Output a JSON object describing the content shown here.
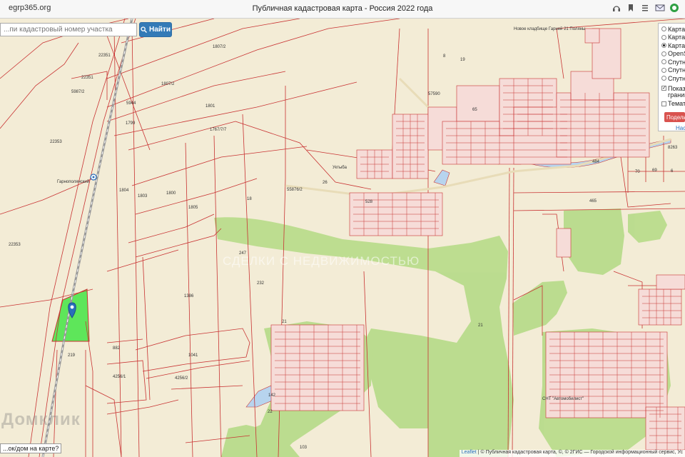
{
  "browser": {
    "url": "egrp365.org",
    "title": "Публичная кадастровая карта - Россия 2022 года"
  },
  "search": {
    "placeholder": "...пи кадастровый номер участка",
    "button_label": "Найти"
  },
  "layers": {
    "options": [
      "Карта",
      "Карта",
      "Карта",
      "OpenS",
      "Спутн",
      "Спутн",
      "Спутн"
    ],
    "selected_index": 2,
    "checkboxes": [
      {
        "label": "Показа границ",
        "checked": true
      },
      {
        "label": "Темати",
        "checked": false
      }
    ],
    "share_label": "Подели",
    "settings_label": "Наст"
  },
  "feedback_label": "...ок/дом на карте?",
  "attribution": {
    "leaflet": "Leaflet",
    "rest": "| © Публичная кадастровая карта, ©, © 2ГИС — Городской информационный сервис, Ус"
  },
  "watermarks": {
    "brand": "Домклик",
    "center": "СДЕЛКИ С НЕДВИЖИМОСТЬЮ"
  },
  "map_labels": {
    "parcel_numbers": [
      "22351",
      "1807/2",
      "22351",
      "5987/2",
      "1807/2",
      "5944",
      "1801",
      "1799",
      "1767/7/7",
      "22353",
      "1804",
      "1803",
      "1800",
      "1805",
      "22353",
      "1386",
      "882",
      "1041",
      "4256/1",
      "4256/2",
      "219",
      "55876/2",
      "18",
      "247",
      "232",
      "21",
      "22",
      "142",
      "103",
      "21",
      "465",
      "484",
      "8263",
      "70",
      "69",
      "6",
      "57590",
      "65",
      "26",
      "528",
      "8",
      "19"
    ],
    "places": [
      "Новое кладбище Гарней 21 Поляны",
      "Гарнополянский",
      "Уктыба",
      "СНТ \"Автомобилист\""
    ],
    "icons": [
      "map-marker-icon",
      "railway-station-icon"
    ]
  },
  "colors": {
    "map_background": "#f3ecd6",
    "parcel_border": "#c83232",
    "forest": "#a8d47c",
    "selected_parcel": "#5ee65a",
    "water": "#b7d4ee",
    "accent_button": "#337ab7",
    "share_button": "#d9534f"
  }
}
